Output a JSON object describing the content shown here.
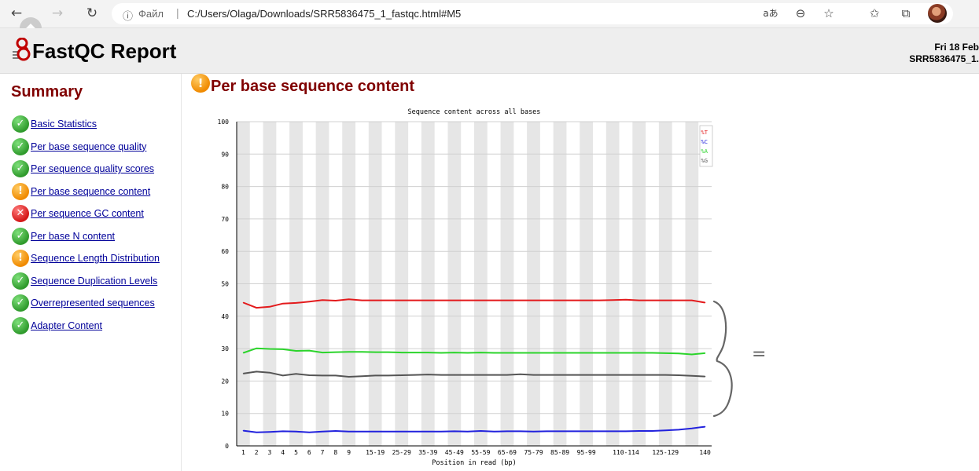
{
  "browser": {
    "back_icon": "←",
    "forward_icon": "→",
    "reload_icon": "↻",
    "info_icon": "ⓘ",
    "address_label": "Файл",
    "address_separator": "|",
    "url": "C:/Users/Olaga/Downloads/SRR5836475_1_fastqc.html#M5",
    "read_aloud_icon": "aあ",
    "zoom_icon": "⊖",
    "favorite_icon": "☆",
    "favorites_icon": "✩",
    "collections_icon": "⧉"
  },
  "report": {
    "title": "FastQC Report",
    "date": "Fri 18 Feb",
    "filename": "SRR5836475_1."
  },
  "summary": {
    "title": "Summary",
    "items": [
      {
        "label": "Basic Statistics",
        "status": "pass",
        "glyph": "✓"
      },
      {
        "label": "Per base sequence quality",
        "status": "pass",
        "glyph": "✓"
      },
      {
        "label": "Per sequence quality scores",
        "status": "pass",
        "glyph": "✓"
      },
      {
        "label": "Per base sequence content",
        "status": "warn",
        "glyph": "!"
      },
      {
        "label": "Per sequence GC content",
        "status": "fail",
        "glyph": "✕"
      },
      {
        "label": "Per base N content",
        "status": "pass",
        "glyph": "✓"
      },
      {
        "label": "Sequence Length Distribution",
        "status": "warn",
        "glyph": "!"
      },
      {
        "label": "Sequence Duplication Levels",
        "status": "pass",
        "glyph": "✓"
      },
      {
        "label": "Overrepresented sequences",
        "status": "pass",
        "glyph": "✓"
      },
      {
        "label": "Adapter Content",
        "status": "pass",
        "glyph": "✓"
      }
    ]
  },
  "module": {
    "title": "Per base sequence content",
    "glyph": "!"
  },
  "annotation": {
    "mark": "="
  },
  "chart_data": {
    "type": "line",
    "title": "Sequence content across all bases",
    "xlabel": "Position in read (bp)",
    "ylabel": "",
    "ylim": [
      0,
      100
    ],
    "y_ticks": [
      0,
      10,
      20,
      30,
      40,
      50,
      60,
      70,
      80,
      90,
      100
    ],
    "grid": true,
    "legend_position": "top-right",
    "categories": [
      "1",
      "2",
      "3",
      "4",
      "5",
      "6",
      "7",
      "8",
      "9",
      "10-14",
      "15-19",
      "20-24",
      "25-29",
      "30-34",
      "35-39",
      "40-44",
      "45-49",
      "50-54",
      "55-59",
      "60-64",
      "65-69",
      "70-74",
      "75-79",
      "80-84",
      "85-89",
      "90-94",
      "95-99",
      "100-104",
      "105-109",
      "110-114",
      "115-119",
      "120-124",
      "125-129",
      "130-134",
      "135-139",
      "140"
    ],
    "x_tick_labels": [
      "1",
      "2",
      "3",
      "4",
      "5",
      "6",
      "7",
      "8",
      "9",
      "15-19",
      "25-29",
      "35-39",
      "45-49",
      "55-59",
      "65-69",
      "75-79",
      "85-89",
      "95-99",
      "110-114",
      "125-129",
      "140"
    ],
    "series": [
      {
        "name": "%T",
        "color": "#e31a1c",
        "values": [
          44.2,
          42.6,
          42.9,
          43.9,
          44.1,
          44.5,
          45.0,
          44.8,
          45.2,
          44.9,
          44.9,
          44.9,
          44.9,
          44.9,
          44.9,
          44.9,
          44.9,
          44.9,
          44.9,
          44.9,
          44.9,
          44.9,
          44.9,
          44.9,
          44.9,
          44.9,
          44.9,
          44.9,
          45.0,
          45.1,
          44.9,
          44.9,
          44.9,
          44.9,
          44.9,
          44.2
        ]
      },
      {
        "name": "%C",
        "color": "#2222dd",
        "values": [
          4.7,
          4.2,
          4.3,
          4.5,
          4.4,
          4.2,
          4.4,
          4.6,
          4.4,
          4.4,
          4.4,
          4.4,
          4.4,
          4.4,
          4.4,
          4.4,
          4.5,
          4.4,
          4.6,
          4.4,
          4.5,
          4.5,
          4.4,
          4.5,
          4.5,
          4.5,
          4.5,
          4.5,
          4.5,
          4.5,
          4.6,
          4.6,
          4.8,
          5.0,
          5.4,
          5.9
        ]
      },
      {
        "name": "%A",
        "color": "#2bd42b",
        "values": [
          28.7,
          30.1,
          29.9,
          29.8,
          29.3,
          29.4,
          28.8,
          28.9,
          29.0,
          29.0,
          28.9,
          28.9,
          28.8,
          28.8,
          28.8,
          28.7,
          28.8,
          28.7,
          28.8,
          28.7,
          28.7,
          28.7,
          28.7,
          28.7,
          28.7,
          28.7,
          28.7,
          28.7,
          28.7,
          28.7,
          28.7,
          28.7,
          28.6,
          28.5,
          28.2,
          28.6
        ]
      },
      {
        "name": "%G",
        "color": "#555555",
        "values": [
          22.3,
          22.9,
          22.6,
          21.7,
          22.2,
          21.8,
          21.7,
          21.7,
          21.3,
          21.5,
          21.7,
          21.7,
          21.8,
          21.9,
          22.0,
          21.9,
          21.9,
          21.9,
          21.9,
          21.9,
          21.9,
          22.1,
          21.9,
          21.9,
          21.9,
          21.9,
          21.9,
          21.9,
          21.9,
          21.9,
          21.9,
          21.9,
          21.9,
          21.8,
          21.6,
          21.4
        ]
      }
    ]
  }
}
